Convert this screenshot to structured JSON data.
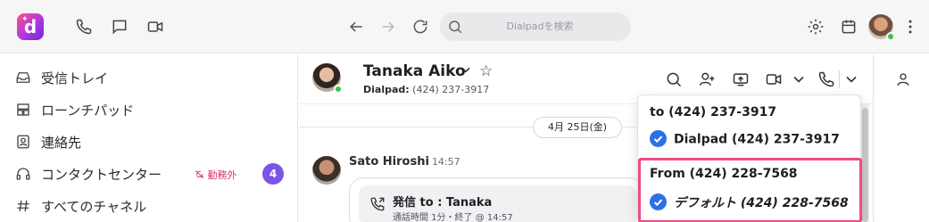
{
  "topbar": {
    "search_placeholder": "Dialpadを検索"
  },
  "sidebar": {
    "items": [
      {
        "label": "受信トレイ",
        "icon": "inbox-icon"
      },
      {
        "label": "ローンチパッド",
        "icon": "launchpad-icon"
      },
      {
        "label": "連絡先",
        "icon": "contacts-icon"
      },
      {
        "label": "コンタクトセンター",
        "icon": "headset-icon",
        "status": "勤務外",
        "badge": "4"
      },
      {
        "label": "すべてのチャネル",
        "icon": "hash-icon"
      }
    ]
  },
  "conversation": {
    "contact_name": "Tanaka Aiko",
    "contact_sub_label": "Dialpad:",
    "contact_sub_number": "(424) 237-3917",
    "date_divider": "4月 25日(金)",
    "message": {
      "sender": "Sato Hiroshi",
      "time": "14:57",
      "call_title": "発信 to : Tanaka",
      "call_meta": "通話時間 1分・終了 @ 14:57"
    }
  },
  "call_dropdown": {
    "to_heading": "to (424) 237-3917",
    "to_option": "Dialpad (424) 237-3917",
    "from_heading": "From (424) 228-7568",
    "from_option": "デフォルト (424) 228-7568"
  },
  "colors": {
    "accent_purple": "#7a55e6",
    "check_blue": "#2d6fe8",
    "highlight_pink": "#ef4b82",
    "status_red": "#d8335f",
    "online_green": "#3cc24a"
  }
}
